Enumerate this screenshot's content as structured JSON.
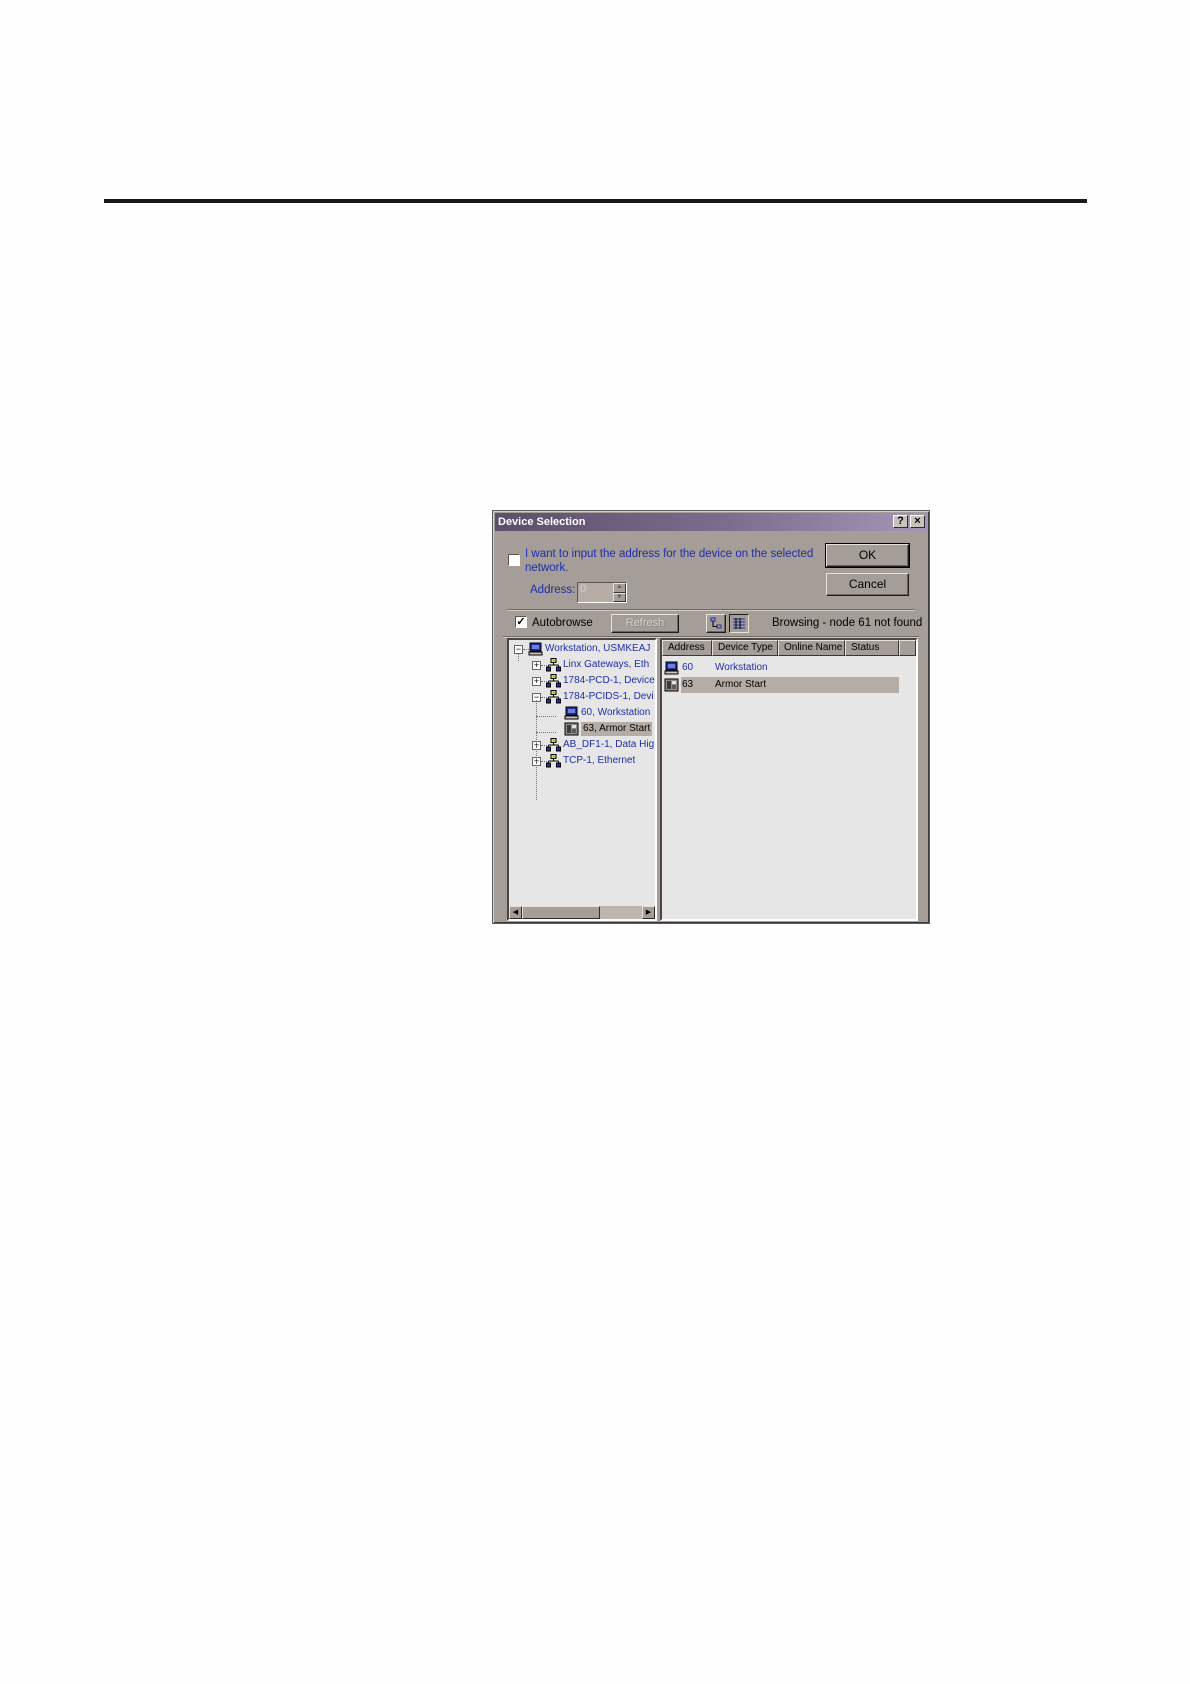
{
  "dialog": {
    "title": "Device Selection",
    "help_glyph": "?",
    "close_glyph": "×",
    "manual_address_checkbox_checked": false,
    "manual_address_label_line1": "I want to input the address for the device on the selected",
    "manual_address_label_line2": "network.",
    "address_label": "Address:",
    "address_value": "0",
    "ok_label": "OK",
    "cancel_label": "Cancel",
    "autobrowse_checked": true,
    "autobrowse_label": "Autobrowse",
    "refresh_label": "Refresh",
    "browse_status": "Browsing - node 61 not found"
  },
  "tree": {
    "items": [
      {
        "expander": "−",
        "icon": "workstation-icon",
        "label": "Workstation, USMKEAJ"
      },
      {
        "expander": "+",
        "icon": "network-icon",
        "label": "Linx Gateways, Eth"
      },
      {
        "expander": "+",
        "icon": "network-icon",
        "label": "1784-PCD-1, Device"
      },
      {
        "expander": "−",
        "icon": "network-icon",
        "label": "1784-PCIDS-1, Devi"
      },
      {
        "expander": "",
        "icon": "workstation-icon",
        "label": "60, Workstation"
      },
      {
        "expander": "",
        "icon": "armorstart-icon",
        "label": "63, Armor Start",
        "selected": true
      },
      {
        "expander": "+",
        "icon": "network-icon",
        "label": "AB_DF1-1, Data Hig"
      },
      {
        "expander": "+",
        "icon": "network-icon",
        "label": "TCP-1, Ethernet"
      }
    ]
  },
  "device_list": {
    "columns": [
      "Address",
      "Device Type",
      "Online Name",
      "Status"
    ],
    "rows": [
      {
        "address": "60",
        "device_type": "Workstation",
        "online_name": "",
        "status": "",
        "icon": "workstation-icon"
      },
      {
        "address": "63",
        "device_type": "Armor Start",
        "online_name": "",
        "status": "",
        "icon": "armorstart-icon",
        "selected": true
      }
    ]
  },
  "colors": {
    "dialog_face": "#a59d97",
    "title_gradient_start": "#5b4f6a",
    "link_blue": "#1e2ea8",
    "pane_background": "#e6e6e6",
    "selection": "#b4aca5"
  }
}
